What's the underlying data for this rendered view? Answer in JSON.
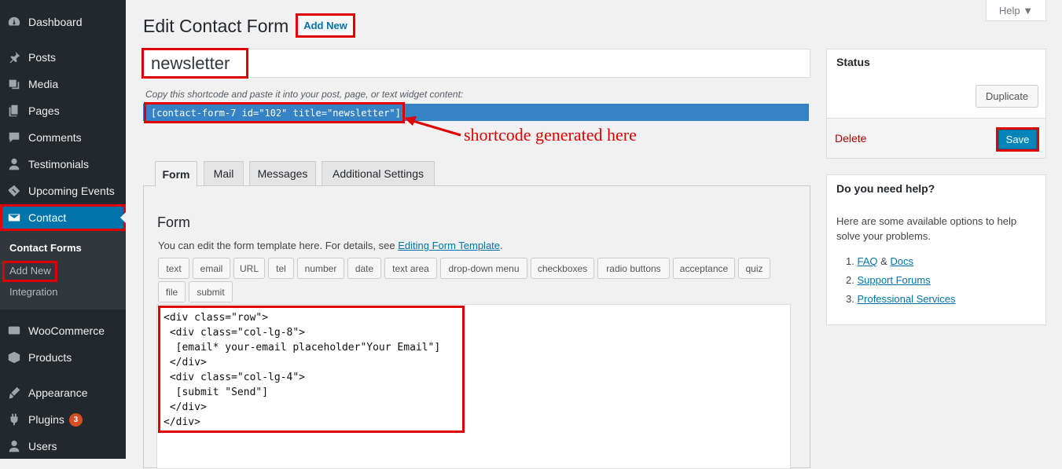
{
  "sidebar": {
    "items": [
      {
        "label": "Dashboard",
        "icon": "dashboard-icon"
      },
      {
        "label": "Posts",
        "icon": "pin-icon"
      },
      {
        "label": "Media",
        "icon": "media-icon"
      },
      {
        "label": "Pages",
        "icon": "pages-icon"
      },
      {
        "label": "Comments",
        "icon": "comment-icon"
      },
      {
        "label": "Testimonials",
        "icon": "user-icon"
      },
      {
        "label": "Upcoming Events",
        "icon": "ticket-icon"
      },
      {
        "label": "Contact",
        "icon": "mail-icon"
      },
      {
        "label": "WooCommerce",
        "icon": "woo-icon"
      },
      {
        "label": "Products",
        "icon": "box-icon"
      },
      {
        "label": "Appearance",
        "icon": "brush-icon"
      },
      {
        "label": "Plugins",
        "icon": "plugin-icon",
        "badge": "3"
      },
      {
        "label": "Users",
        "icon": "users-icon"
      }
    ],
    "submenu": [
      "Contact Forms",
      "Add New",
      "Integration"
    ]
  },
  "header": {
    "title": "Edit Contact Form",
    "add_new": "Add New",
    "help": "Help ▼"
  },
  "form_title": "newsletter",
  "shortcode": {
    "hint": "Copy this shortcode and paste it into your post, page, or text widget content:",
    "value": "[contact-form-7 id=\"102\" title=\"newsletter\"]"
  },
  "annotation": "shortcode generated here",
  "tabs": [
    "Form",
    "Mail",
    "Messages",
    "Additional Settings"
  ],
  "form_panel": {
    "heading": "Form",
    "desc_prefix": "You can edit the form template here. For details, see ",
    "desc_link": "Editing Form Template",
    "desc_suffix": ".",
    "tag_buttons": [
      "text",
      "email",
      "URL",
      "tel",
      "number",
      "date",
      "text area",
      "drop-down menu",
      "checkboxes",
      "radio buttons",
      "acceptance",
      "quiz",
      "file",
      "submit"
    ],
    "code": "<div class=\"row\">\n <div class=\"col-lg-8\">\n  [email* your-email placeholder\"Your Email\"]\n </div>\n <div class=\"col-lg-4\">\n  [submit \"Send\"]\n </div>\n</div>"
  },
  "status": {
    "title": "Status",
    "duplicate": "Duplicate",
    "delete": "Delete",
    "save": "Save"
  },
  "help_box": {
    "title": "Do you need help?",
    "desc": "Here are some available options to help solve your problems.",
    "item1_num": "1.",
    "item1_link_a": "FAQ",
    "item1_amp": " & ",
    "item1_link_b": "Docs",
    "item2_num": "2.",
    "item2_link": "Support Forums",
    "item3_num": "3.",
    "item3_link": "Professional Services"
  }
}
